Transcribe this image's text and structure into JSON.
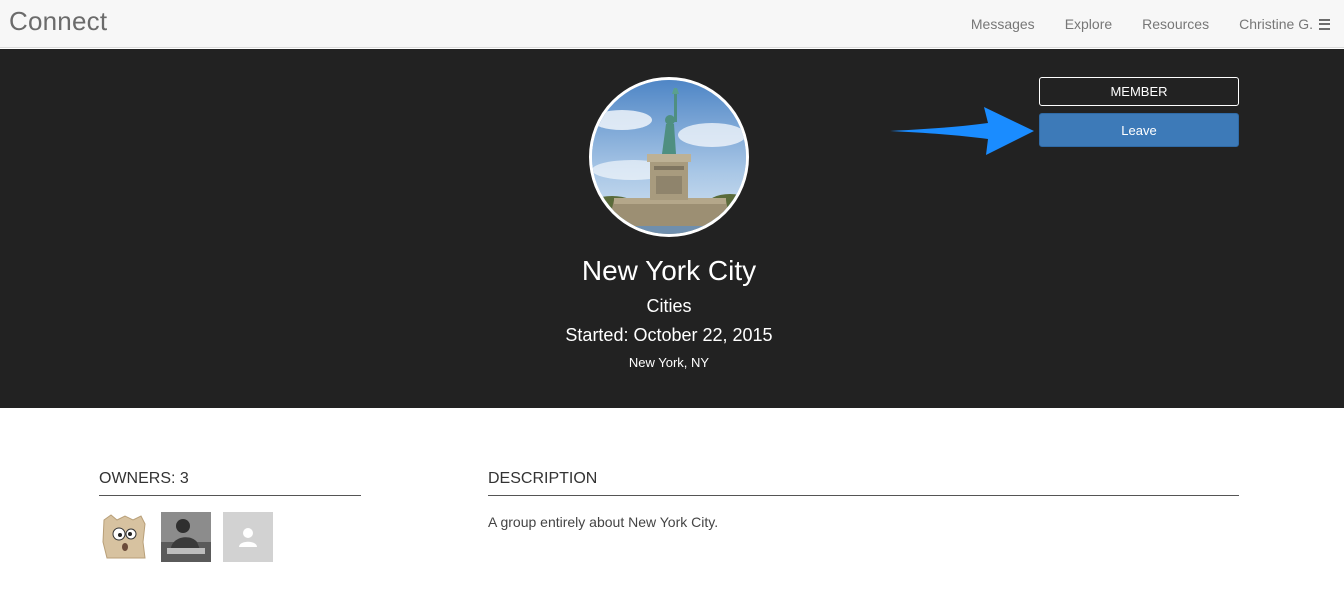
{
  "header": {
    "brand": "Connect",
    "nav": [
      "Messages",
      "Explore",
      "Resources"
    ],
    "user": "Christine G.",
    "menu_icon": "hamburger-menu-icon"
  },
  "group": {
    "name": "New York City",
    "category": "Cities",
    "started": "Started: October 22, 2015",
    "location": "New York, NY",
    "avatar_image": "statue-of-liberty-photo"
  },
  "actions": {
    "membership_status": "MEMBER",
    "leave_label": "Leave",
    "arrow_color": "#1a8cff",
    "button_color": "#3d7ab8"
  },
  "owners": {
    "heading": "OWNERS: 3",
    "avatars": [
      "cartoon-face-avatar",
      "photo-avatar",
      "default-user-avatar"
    ]
  },
  "description": {
    "heading": "DESCRIPTION",
    "text": "A group entirely about New York City."
  }
}
